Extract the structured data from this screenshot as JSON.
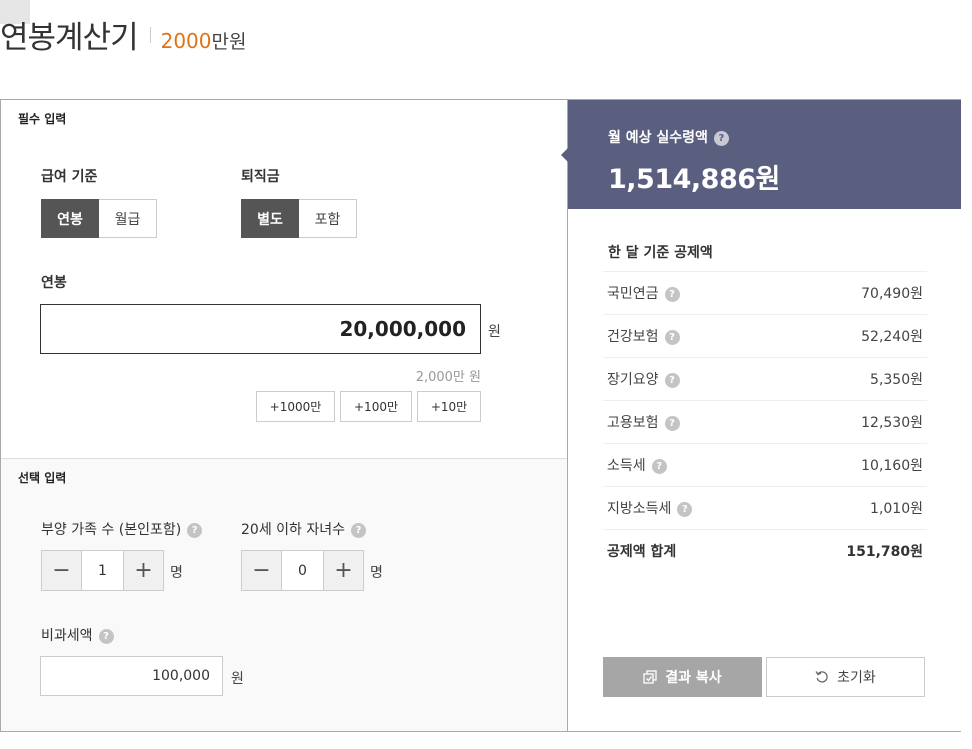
{
  "header": {
    "title": "연봉계산기",
    "amount": "2000",
    "amount_unit": "만원"
  },
  "required": {
    "section_title": "필수 입력",
    "pay_basis": {
      "label": "급여 기준",
      "options": [
        "연봉",
        "월급"
      ],
      "selected": "연봉"
    },
    "severance": {
      "label": "퇴직금",
      "options": [
        "별도",
        "포함"
      ],
      "selected": "별도"
    },
    "salary": {
      "label": "연봉",
      "value": "20,000,000",
      "unit": "원",
      "hint": "2,000만 원"
    },
    "add_buttons": [
      "+1000만",
      "+100만",
      "+10만"
    ]
  },
  "optional": {
    "section_title": "선택 입력",
    "dependents": {
      "label": "부양 가족 수 (본인포함)",
      "value": "1",
      "unit": "명"
    },
    "children": {
      "label": "20세 이하 자녀수",
      "value": "0",
      "unit": "명"
    },
    "tax_free": {
      "label": "비과세액",
      "value": "100,000",
      "unit": "원"
    }
  },
  "result": {
    "label": "월 예상 실수령액",
    "value": "1,514,886원",
    "deduction_title": "한 달 기준 공제액",
    "deductions": [
      {
        "name": "국민연금",
        "amount": "70,490원"
      },
      {
        "name": "건강보험",
        "amount": "52,240원"
      },
      {
        "name": "장기요양",
        "amount": "5,350원"
      },
      {
        "name": "고용보험",
        "amount": "12,530원"
      },
      {
        "name": "소득세",
        "amount": "10,160원"
      },
      {
        "name": "지방소득세",
        "amount": "1,010원"
      }
    ],
    "total": {
      "name": "공제액 합계",
      "amount": "151,780원"
    },
    "copy_label": "결과 복사",
    "reset_label": "초기화"
  },
  "icons": {
    "help": "?",
    "minus": "−",
    "plus": "+"
  },
  "colors": {
    "accent_orange": "#e07318",
    "result_bg": "#5b5f7f",
    "toggle_on": "#555555",
    "copy_button": "#a6a6a6"
  }
}
